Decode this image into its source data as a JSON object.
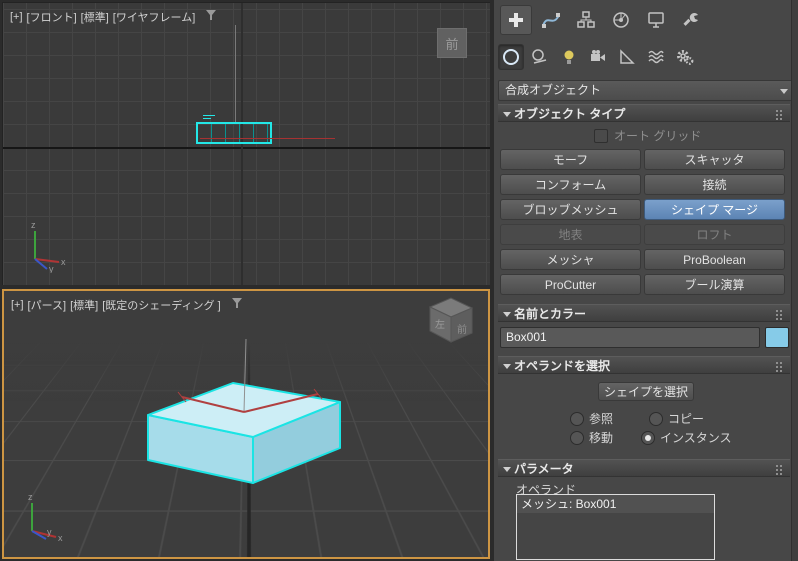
{
  "viewports": {
    "front": {
      "menu_plus": "[+]",
      "menu_view": "[フロント]",
      "menu_standard": "[標準]",
      "menu_shading": "[ワイヤフレーム]",
      "viewcube": "前"
    },
    "persp": {
      "menu_plus": "[+]",
      "menu_view": "[パース]",
      "menu_standard": "[標準]",
      "menu_shading": "[既定のシェーディング ]",
      "viewcube_left": "左",
      "viewcube_front": "前"
    },
    "axes": {
      "x": "x",
      "y": "y",
      "z": "z"
    }
  },
  "colors": {
    "active_viewport_border": "#cd9543",
    "selection_cyan": "#1be4e4",
    "active_button_blue": "#6b93c4",
    "object_color": "#86cbe8"
  },
  "panel": {
    "tabs": [
      {
        "icon": "create-icon",
        "active": true
      },
      {
        "icon": "modify-icon"
      },
      {
        "icon": "hierarchy-icon"
      },
      {
        "icon": "motion-icon"
      },
      {
        "icon": "display-icon"
      },
      {
        "icon": "utilities-icon"
      }
    ],
    "categories": [
      {
        "icon": "geometry-icon",
        "active": true
      },
      {
        "icon": "shapes-icon"
      },
      {
        "icon": "lights-icon"
      },
      {
        "icon": "cameras-icon"
      },
      {
        "icon": "helpers-icon"
      },
      {
        "icon": "space-warps-icon"
      },
      {
        "icon": "systems-icon"
      }
    ],
    "dropdown": {
      "value": "合成オブジェクト"
    },
    "object_type": {
      "title": "オブジェクト タイプ",
      "autogrid_label": "オート グリッド",
      "buttons": [
        {
          "label": "モーフ",
          "state": "normal"
        },
        {
          "label": "スキャッタ",
          "state": "normal"
        },
        {
          "label": "コンフォーム",
          "state": "normal"
        },
        {
          "label": "接続",
          "state": "normal"
        },
        {
          "label": "ブロッブメッシュ",
          "state": "normal"
        },
        {
          "label": "シェイプ マージ",
          "state": "active"
        },
        {
          "label": "地表",
          "state": "disabled"
        },
        {
          "label": "ロフト",
          "state": "disabled"
        },
        {
          "label": "メッシャ",
          "state": "normal"
        },
        {
          "label": "ProBoolean",
          "state": "normal"
        },
        {
          "label": "ProCutter",
          "state": "normal"
        },
        {
          "label": "ブール演算",
          "state": "normal"
        }
      ]
    },
    "name_color": {
      "title": "名前とカラー",
      "name_value": "Box001",
      "color": "#86cbe8"
    },
    "pick_operand": {
      "title": "オペランドを選択",
      "pick_button": "シェイプを選択",
      "radios": [
        {
          "label": "参照",
          "checked": false
        },
        {
          "label": "コピー",
          "checked": false
        },
        {
          "label": "移動",
          "checked": false
        },
        {
          "label": "インスタンス",
          "checked": true
        }
      ]
    },
    "parameters": {
      "title": "パラメータ",
      "group_label": "オペランド",
      "list_items": [
        "メッシュ: Box001"
      ]
    }
  }
}
